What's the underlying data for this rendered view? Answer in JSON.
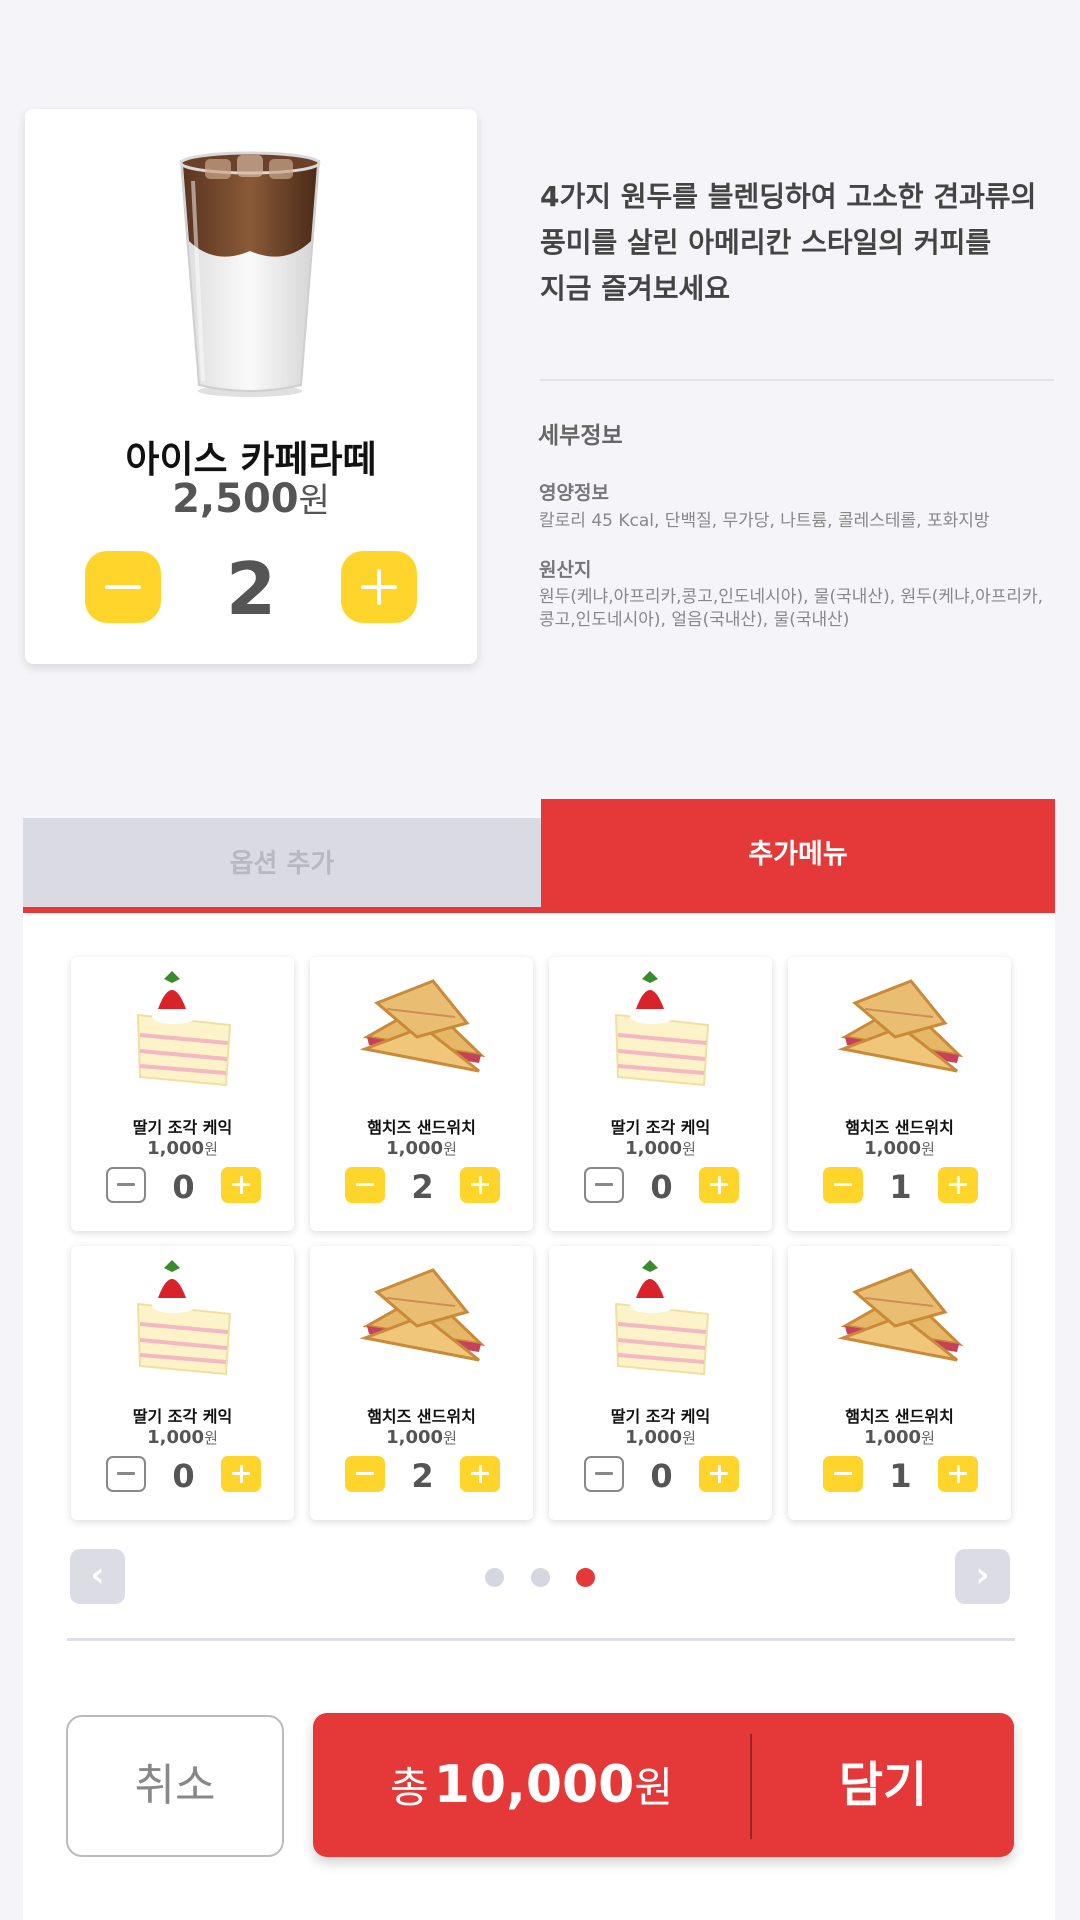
{
  "product": {
    "name": "아이스 카페라떼",
    "price": "2,500",
    "currency": "원",
    "quantity": "2",
    "image": "iced-latte-glass"
  },
  "description": "4가지 원두를 블렌딩하여 고소한 견과류의\n풍미를 살린 아메리칸 스타일의 커피를\n지금 즐겨보세요",
  "details": {
    "title": "세부정보",
    "nutrition_label": "영양정보",
    "nutrition_text": "칼로리 45 Kcal, 단백질, 무가당, 나트륨, 콜레스테롤, 포화지방",
    "origin_label": "원산지",
    "origin_text": "원두(케냐,아프리카,콩고,인도네시아), 물(국내산), 원두(케냐,아프리카, 콩고,인도네시아), 얼음(국내산), 물(국내산)"
  },
  "tabs": [
    {
      "label": "옵션 추가",
      "active": false
    },
    {
      "label": "추가메뉴",
      "active": true
    }
  ],
  "items": [
    {
      "name": "딸기 조각 케익",
      "price": "1,000",
      "unit": "원",
      "qty": "0",
      "image": "strawberry-cake-slice"
    },
    {
      "name": "햄치즈 샌드위치",
      "price": "1,000",
      "unit": "원",
      "qty": "2",
      "image": "ham-cheese-sandwich"
    },
    {
      "name": "딸기 조각 케익",
      "price": "1,000",
      "unit": "원",
      "qty": "0",
      "image": "strawberry-cake-slice"
    },
    {
      "name": "햄치즈 샌드위치",
      "price": "1,000",
      "unit": "원",
      "qty": "1",
      "image": "ham-cheese-sandwich"
    },
    {
      "name": "딸기 조각 케익",
      "price": "1,000",
      "unit": "원",
      "qty": "0",
      "image": "strawberry-cake-slice"
    },
    {
      "name": "햄치즈 샌드위치",
      "price": "1,000",
      "unit": "원",
      "qty": "2",
      "image": "ham-cheese-sandwich"
    },
    {
      "name": "딸기 조각 케익",
      "price": "1,000",
      "unit": "원",
      "qty": "0",
      "image": "strawberry-cake-slice"
    },
    {
      "name": "햄치즈 샌드위치",
      "price": "1,000",
      "unit": "원",
      "qty": "1",
      "image": "ham-cheese-sandwich"
    }
  ],
  "pagination": {
    "prev_glyph": "‹",
    "next_glyph": "›",
    "total_pages": 3,
    "current_page": 3
  },
  "footer": {
    "cancel_label": "취소",
    "total_prefix": "총",
    "total_amount": "10,000",
    "total_unit": "원",
    "add_label": "담기"
  },
  "colors": {
    "accent_red": "#e53838",
    "accent_yellow": "#ffd52b",
    "background": "#f5f5f9",
    "tab_inactive": "#dadae3"
  }
}
